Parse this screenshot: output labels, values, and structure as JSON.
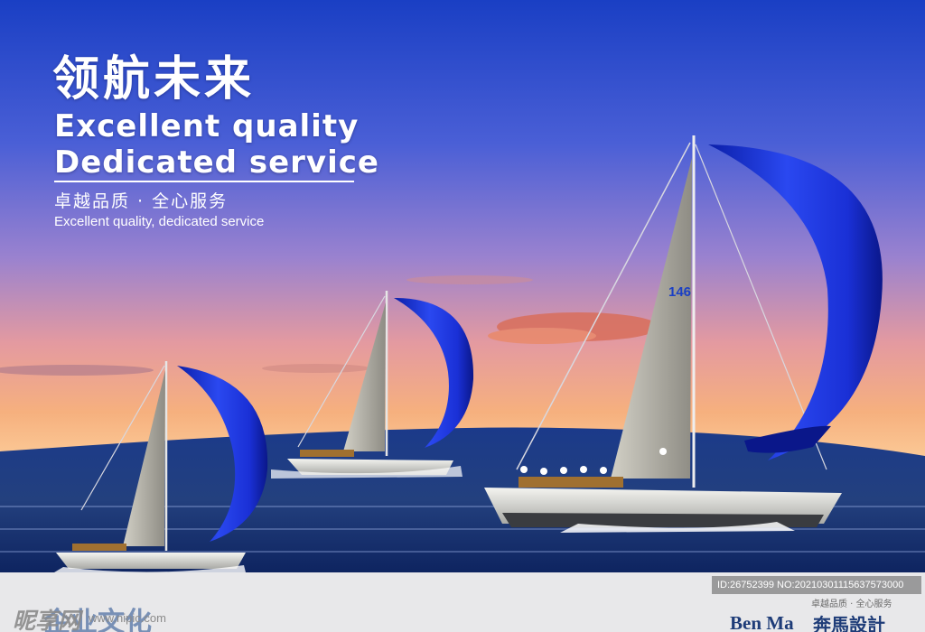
{
  "headline": {
    "title_cn": "领航未来",
    "title_en_line1": "Excellent quality",
    "title_en_line2": "Dedicated service",
    "subtitle_cn": "卓越品质 · 全心服务",
    "subtitle_en": "Excellent quality, dedicated service"
  },
  "scene": {
    "sail_number": "146",
    "colors": {
      "sky_top": "#1f44c8",
      "sky_mid": "#7a6fd0",
      "sky_horizon": "#f7b880",
      "sea": "#16307a",
      "spinnaker": "#1a2fd9",
      "mainsail": "#b8b6ac",
      "hull": "#e6e6e2"
    }
  },
  "footer": {
    "watermark_logo": "昵享网",
    "watermark_url": "www.nipic.com",
    "faded_title": "企业文化",
    "image_id": "ID:26752399 NO:20210301115637573000",
    "small_slogan": "卓越品质 · 全心服务",
    "brand_en": "Ben Ma",
    "brand_cn": "奔馬設計"
  }
}
